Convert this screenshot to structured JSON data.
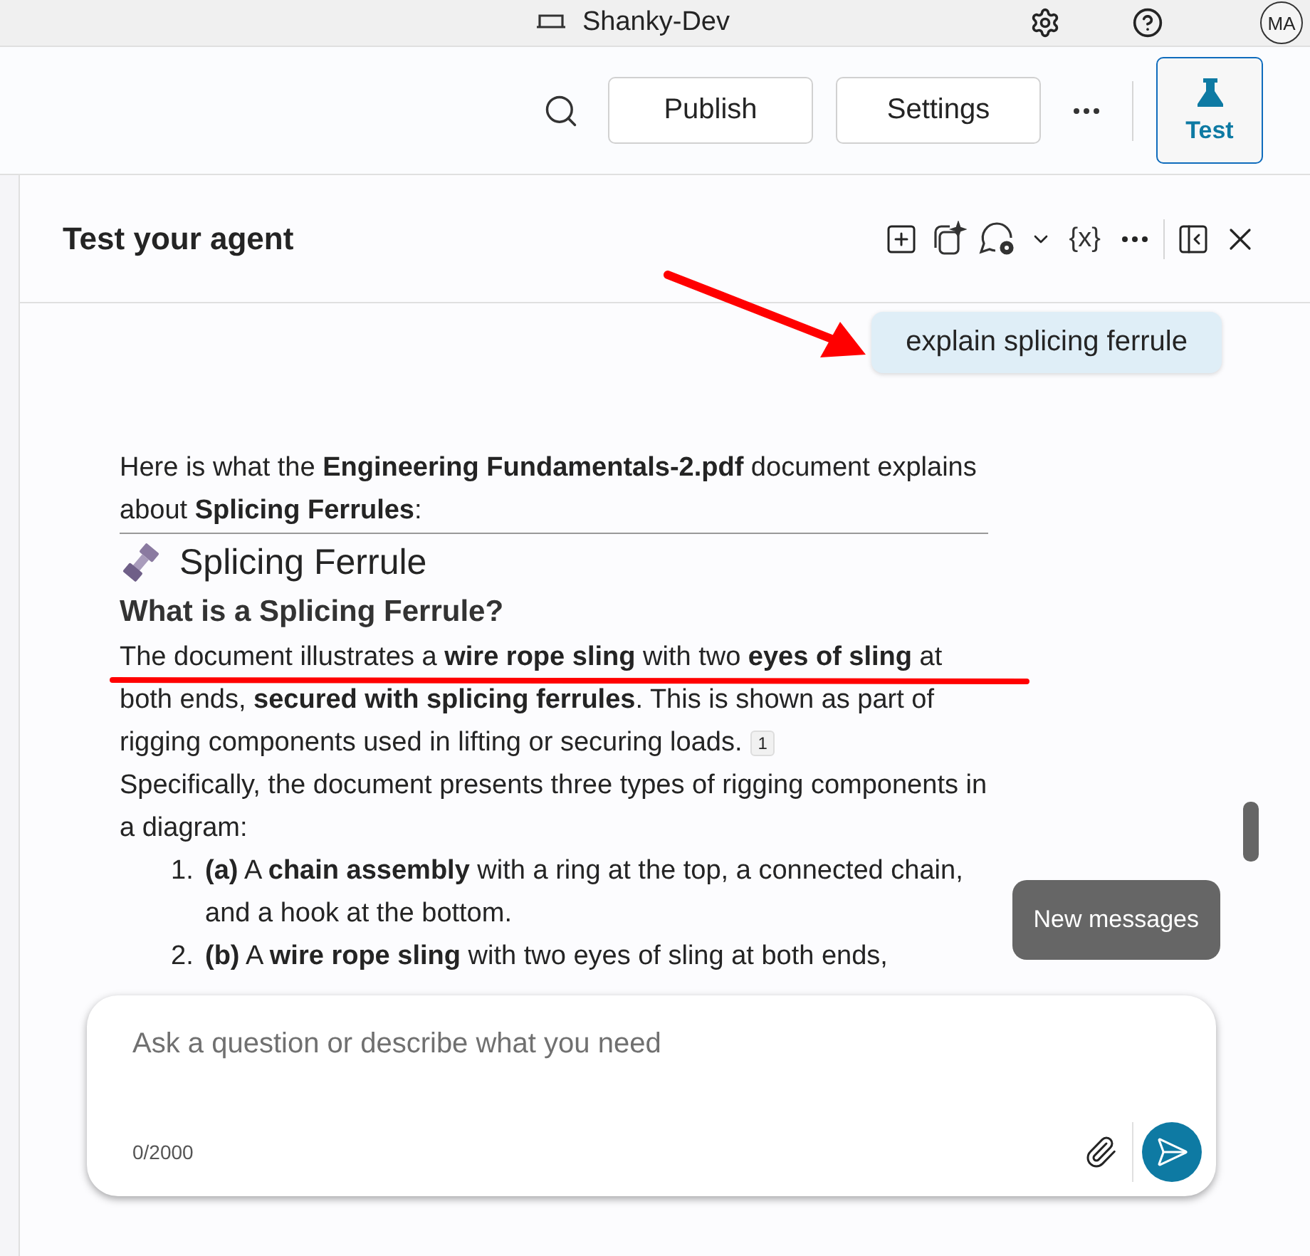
{
  "top_bar": {
    "environment": "Shanky-Dev",
    "avatar": "MA"
  },
  "toolbar": {
    "buttons": [
      "Publish",
      "Settings"
    ],
    "test_button": {
      "label": "Test",
      "selected": true
    }
  },
  "panel": {
    "title": "Test your agent",
    "variables_icon": "{x}",
    "user_message": "explain splicing ferrule",
    "response": [
      {
        "kind": "paragraph",
        "text": "Here is what the **Engineering Fundamentals-2.pdf** document explains about **Splicing Ferrules**:",
        "rule": true
      },
      {
        "kind": "heading",
        "text": "Splicing Ferrule"
      },
      {
        "kind": "subheading",
        "text": "What is a Splicing Ferrule?"
      },
      {
        "kind": "paragraph",
        "text": "The document illustrates a **wire rope sling** with two **eyes of sling** at both ends, **secured with splicing ferrules**. This is shown as part of rigging components used in lifting or securing loads.",
        "citation": "1",
        "annotated": true
      },
      {
        "kind": "paragraph",
        "text": "Specifically, the document presents three types of rigging components in a diagram:"
      },
      {
        "kind": "list_item",
        "number": "1.",
        "text": "**(a)** A **chain assembly** with a ring at the top, a connected chain, and a hook at the bottom."
      },
      {
        "kind": "list_item",
        "number": "2.",
        "text": "**(b)** A **wire rope sling** with two eyes of sling at both ends,"
      }
    ],
    "new_messages": "New messages",
    "input": {
      "placeholder": "Ask a question or describe what you need",
      "counter": "0/2000"
    }
  }
}
